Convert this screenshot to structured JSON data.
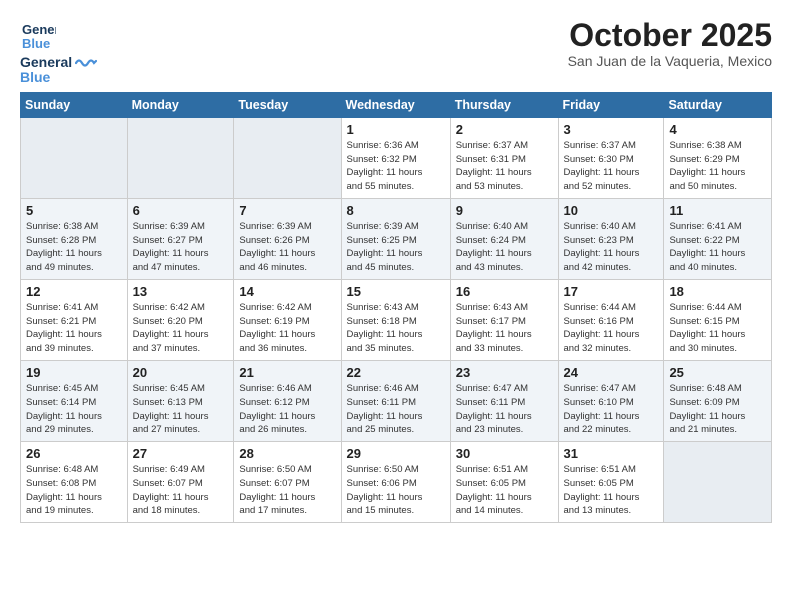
{
  "header": {
    "logo_line1": "General",
    "logo_line2": "Blue",
    "month_title": "October 2025",
    "location": "San Juan de la Vaqueria, Mexico"
  },
  "weekdays": [
    "Sunday",
    "Monday",
    "Tuesday",
    "Wednesday",
    "Thursday",
    "Friday",
    "Saturday"
  ],
  "weeks": [
    [
      {
        "day": "",
        "info": ""
      },
      {
        "day": "",
        "info": ""
      },
      {
        "day": "",
        "info": ""
      },
      {
        "day": "1",
        "info": "Sunrise: 6:36 AM\nSunset: 6:32 PM\nDaylight: 11 hours\nand 55 minutes."
      },
      {
        "day": "2",
        "info": "Sunrise: 6:37 AM\nSunset: 6:31 PM\nDaylight: 11 hours\nand 53 minutes."
      },
      {
        "day": "3",
        "info": "Sunrise: 6:37 AM\nSunset: 6:30 PM\nDaylight: 11 hours\nand 52 minutes."
      },
      {
        "day": "4",
        "info": "Sunrise: 6:38 AM\nSunset: 6:29 PM\nDaylight: 11 hours\nand 50 minutes."
      }
    ],
    [
      {
        "day": "5",
        "info": "Sunrise: 6:38 AM\nSunset: 6:28 PM\nDaylight: 11 hours\nand 49 minutes."
      },
      {
        "day": "6",
        "info": "Sunrise: 6:39 AM\nSunset: 6:27 PM\nDaylight: 11 hours\nand 47 minutes."
      },
      {
        "day": "7",
        "info": "Sunrise: 6:39 AM\nSunset: 6:26 PM\nDaylight: 11 hours\nand 46 minutes."
      },
      {
        "day": "8",
        "info": "Sunrise: 6:39 AM\nSunset: 6:25 PM\nDaylight: 11 hours\nand 45 minutes."
      },
      {
        "day": "9",
        "info": "Sunrise: 6:40 AM\nSunset: 6:24 PM\nDaylight: 11 hours\nand 43 minutes."
      },
      {
        "day": "10",
        "info": "Sunrise: 6:40 AM\nSunset: 6:23 PM\nDaylight: 11 hours\nand 42 minutes."
      },
      {
        "day": "11",
        "info": "Sunrise: 6:41 AM\nSunset: 6:22 PM\nDaylight: 11 hours\nand 40 minutes."
      }
    ],
    [
      {
        "day": "12",
        "info": "Sunrise: 6:41 AM\nSunset: 6:21 PM\nDaylight: 11 hours\nand 39 minutes."
      },
      {
        "day": "13",
        "info": "Sunrise: 6:42 AM\nSunset: 6:20 PM\nDaylight: 11 hours\nand 37 minutes."
      },
      {
        "day": "14",
        "info": "Sunrise: 6:42 AM\nSunset: 6:19 PM\nDaylight: 11 hours\nand 36 minutes."
      },
      {
        "day": "15",
        "info": "Sunrise: 6:43 AM\nSunset: 6:18 PM\nDaylight: 11 hours\nand 35 minutes."
      },
      {
        "day": "16",
        "info": "Sunrise: 6:43 AM\nSunset: 6:17 PM\nDaylight: 11 hours\nand 33 minutes."
      },
      {
        "day": "17",
        "info": "Sunrise: 6:44 AM\nSunset: 6:16 PM\nDaylight: 11 hours\nand 32 minutes."
      },
      {
        "day": "18",
        "info": "Sunrise: 6:44 AM\nSunset: 6:15 PM\nDaylight: 11 hours\nand 30 minutes."
      }
    ],
    [
      {
        "day": "19",
        "info": "Sunrise: 6:45 AM\nSunset: 6:14 PM\nDaylight: 11 hours\nand 29 minutes."
      },
      {
        "day": "20",
        "info": "Sunrise: 6:45 AM\nSunset: 6:13 PM\nDaylight: 11 hours\nand 27 minutes."
      },
      {
        "day": "21",
        "info": "Sunrise: 6:46 AM\nSunset: 6:12 PM\nDaylight: 11 hours\nand 26 minutes."
      },
      {
        "day": "22",
        "info": "Sunrise: 6:46 AM\nSunset: 6:11 PM\nDaylight: 11 hours\nand 25 minutes."
      },
      {
        "day": "23",
        "info": "Sunrise: 6:47 AM\nSunset: 6:11 PM\nDaylight: 11 hours\nand 23 minutes."
      },
      {
        "day": "24",
        "info": "Sunrise: 6:47 AM\nSunset: 6:10 PM\nDaylight: 11 hours\nand 22 minutes."
      },
      {
        "day": "25",
        "info": "Sunrise: 6:48 AM\nSunset: 6:09 PM\nDaylight: 11 hours\nand 21 minutes."
      }
    ],
    [
      {
        "day": "26",
        "info": "Sunrise: 6:48 AM\nSunset: 6:08 PM\nDaylight: 11 hours\nand 19 minutes."
      },
      {
        "day": "27",
        "info": "Sunrise: 6:49 AM\nSunset: 6:07 PM\nDaylight: 11 hours\nand 18 minutes."
      },
      {
        "day": "28",
        "info": "Sunrise: 6:50 AM\nSunset: 6:07 PM\nDaylight: 11 hours\nand 17 minutes."
      },
      {
        "day": "29",
        "info": "Sunrise: 6:50 AM\nSunset: 6:06 PM\nDaylight: 11 hours\nand 15 minutes."
      },
      {
        "day": "30",
        "info": "Sunrise: 6:51 AM\nSunset: 6:05 PM\nDaylight: 11 hours\nand 14 minutes."
      },
      {
        "day": "31",
        "info": "Sunrise: 6:51 AM\nSunset: 6:05 PM\nDaylight: 11 hours\nand 13 minutes."
      },
      {
        "day": "",
        "info": ""
      }
    ]
  ]
}
